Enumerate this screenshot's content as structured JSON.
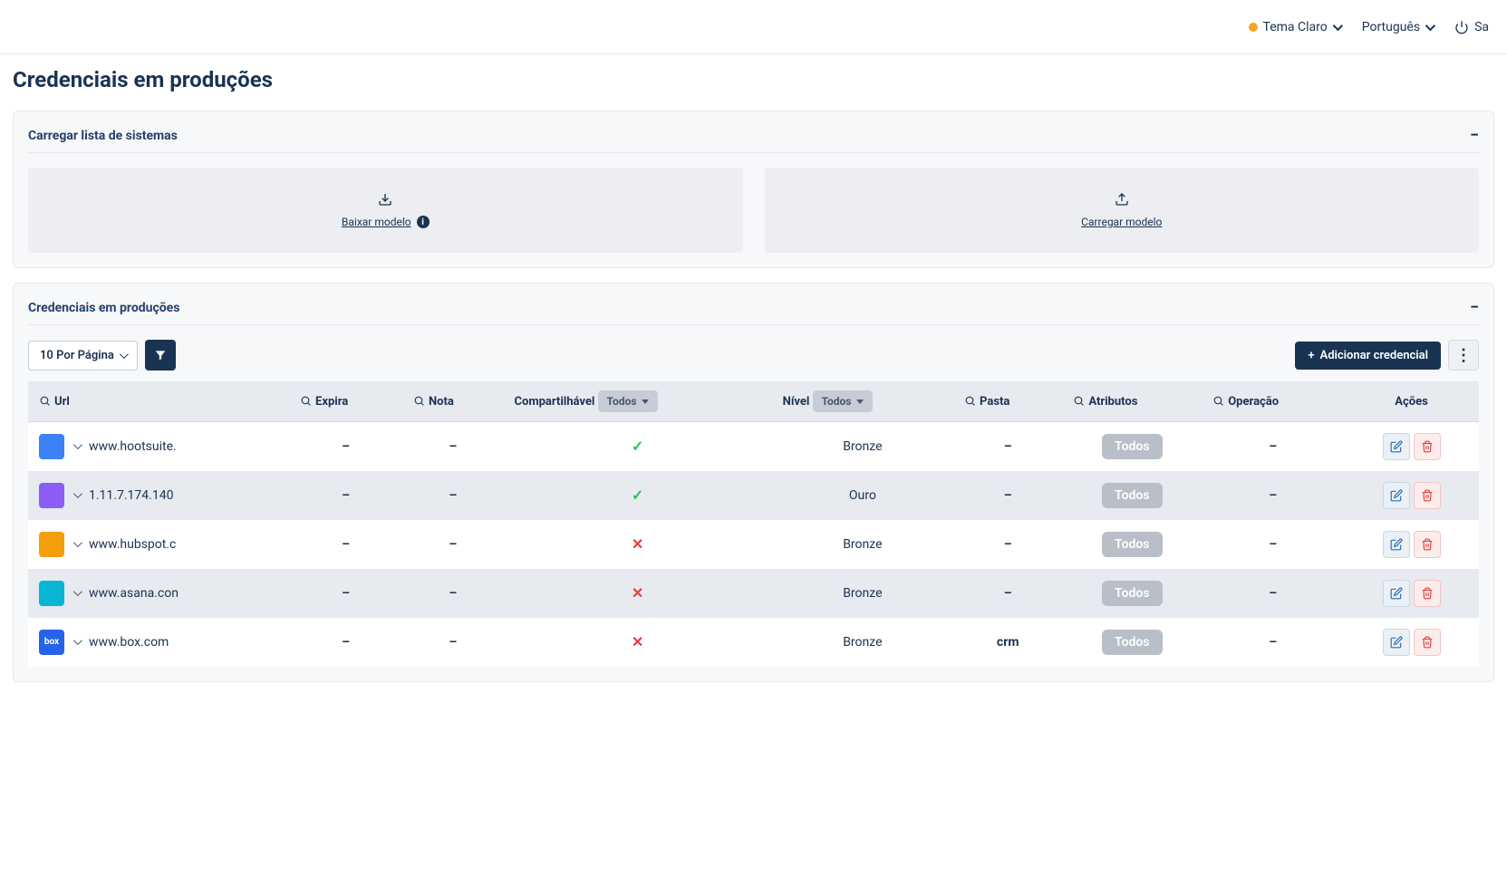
{
  "topbar": {
    "theme_label": "Tema Claro",
    "language_label": "Português",
    "logout_prefix": "Sa"
  },
  "page_title": "Credenciais em produções",
  "panel_upload": {
    "title": "Carregar lista de sistemas",
    "download_label": "Baixar modelo",
    "upload_label": "Carregar modelo"
  },
  "panel_table": {
    "title": "Credenciais em produções",
    "per_page_label": "10 Por Página",
    "add_button": "Adicionar credencial"
  },
  "columns": {
    "url": "Url",
    "expira": "Expira",
    "nota": "Nota",
    "compartilhavel": "Compartilhável",
    "nivel": "Nível",
    "pasta": "Pasta",
    "atributos": "Atributos",
    "operacao": "Operação",
    "acoes": "Ações",
    "todos_label": "Todos"
  },
  "rows": [
    {
      "url": "www.hootsuite.",
      "icon_bg": "#3b82f6",
      "icon_text": "",
      "expira": "–",
      "nota": "–",
      "shareable": true,
      "nivel": "Bronze",
      "pasta": "–",
      "atributos": "Todos",
      "operacao": "–"
    },
    {
      "url": "1.11.7.174.140",
      "icon_bg": "#8b5cf6",
      "icon_text": "",
      "expira": "–",
      "nota": "–",
      "shareable": true,
      "nivel": "Ouro",
      "pasta": "–",
      "atributos": "Todos",
      "operacao": "–"
    },
    {
      "url": "www.hubspot.c",
      "icon_bg": "#f59e0b",
      "icon_text": "",
      "expira": "–",
      "nota": "–",
      "shareable": false,
      "nivel": "Bronze",
      "pasta": "–",
      "atributos": "Todos",
      "operacao": "–"
    },
    {
      "url": "www.asana.con",
      "icon_bg": "#06b6d4",
      "icon_text": "",
      "expira": "–",
      "nota": "–",
      "shareable": false,
      "nivel": "Bronze",
      "pasta": "–",
      "atributos": "Todos",
      "operacao": "–"
    },
    {
      "url": "www.box.com",
      "icon_bg": "#2563eb",
      "icon_text": "box",
      "expira": "–",
      "nota": "–",
      "shareable": false,
      "nivel": "Bronze",
      "pasta": "crm",
      "atributos": "Todos",
      "operacao": "–"
    }
  ]
}
